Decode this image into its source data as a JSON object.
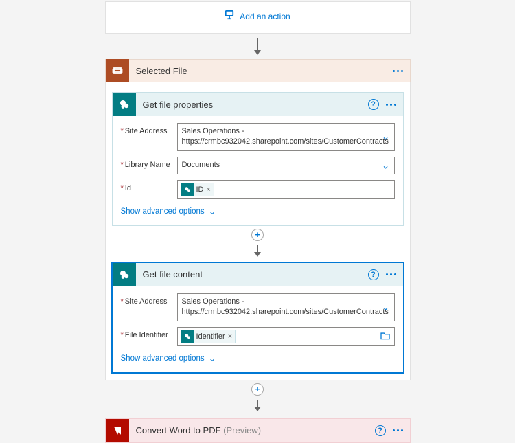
{
  "addAction": {
    "label": "Add an action"
  },
  "selectedFile": {
    "title": "Selected File"
  },
  "sharepointIconLetter": "S",
  "getFileProperties": {
    "title": "Get file properties",
    "fields": {
      "siteAddress": {
        "label": "Site Address",
        "line1": "Sales Operations -",
        "line2": "https://crmbc932042.sharepoint.com/sites/CustomerContracts"
      },
      "libraryName": {
        "label": "Library Name",
        "value": "Documents"
      },
      "id": {
        "label": "Id",
        "tokenLabel": "ID"
      }
    },
    "advanced": "Show advanced options"
  },
  "getFileContent": {
    "title": "Get file content",
    "fields": {
      "siteAddress": {
        "label": "Site Address",
        "line1": "Sales Operations -",
        "line2": "https://crmbc932042.sharepoint.com/sites/CustomerContracts"
      },
      "fileIdentifier": {
        "label": "File Identifier",
        "tokenLabel": "Identifier"
      }
    },
    "advanced": "Show advanced options"
  },
  "convert": {
    "title": "Convert Word to PDF",
    "preview": "(Preview)"
  }
}
